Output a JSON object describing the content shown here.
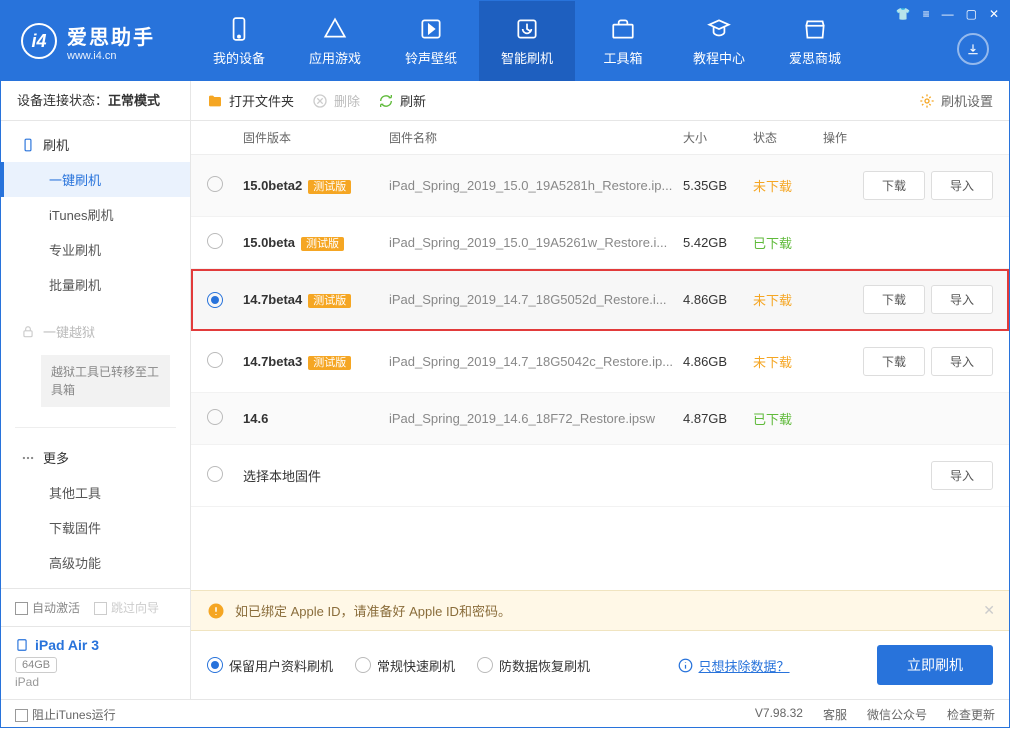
{
  "app": {
    "name": "爱思助手",
    "url": "www.i4.cn"
  },
  "nav": [
    "我的设备",
    "应用游戏",
    "铃声壁纸",
    "智能刷机",
    "工具箱",
    "教程中心",
    "爱思商城"
  ],
  "activeNav": 3,
  "status": {
    "label": "设备连接状态：",
    "value": "正常模式"
  },
  "sidebar": {
    "flash": {
      "title": "刷机",
      "items": [
        "一键刷机",
        "iTunes刷机",
        "专业刷机",
        "批量刷机"
      ],
      "active": 0
    },
    "jailbreak": {
      "title": "一键越狱",
      "note": "越狱工具已转移至工具箱"
    },
    "more": {
      "title": "更多",
      "items": [
        "其他工具",
        "下载固件",
        "高级功能"
      ]
    }
  },
  "bottomChecks": {
    "auto": "自动激活",
    "skip": "跳过向导"
  },
  "device": {
    "name": "iPad Air 3",
    "capacity": "64GB",
    "kind": "iPad"
  },
  "toolbar": {
    "open": "打开文件夹",
    "delete": "删除",
    "refresh": "刷新",
    "settings": "刷机设置"
  },
  "columns": {
    "ver": "固件版本",
    "name": "固件名称",
    "size": "大小",
    "status": "状态",
    "ops": "操作"
  },
  "rows": [
    {
      "ver": "15.0beta2",
      "beta": true,
      "name": "iPad_Spring_2019_15.0_19A5281h_Restore.ip...",
      "size": "5.35GB",
      "status": "未下载",
      "sc": "not",
      "dl": true,
      "imp": true,
      "sel": false
    },
    {
      "ver": "15.0beta",
      "beta": true,
      "name": "iPad_Spring_2019_15.0_19A5261w_Restore.i...",
      "size": "5.42GB",
      "status": "已下载",
      "sc": "done",
      "dl": false,
      "imp": false,
      "sel": false
    },
    {
      "ver": "14.7beta4",
      "beta": true,
      "name": "iPad_Spring_2019_14.7_18G5052d_Restore.i...",
      "size": "4.86GB",
      "status": "未下载",
      "sc": "not",
      "dl": true,
      "imp": true,
      "sel": true,
      "hl": true
    },
    {
      "ver": "14.7beta3",
      "beta": true,
      "name": "iPad_Spring_2019_14.7_18G5042c_Restore.ip...",
      "size": "4.86GB",
      "status": "未下载",
      "sc": "not",
      "dl": true,
      "imp": true,
      "sel": false
    },
    {
      "ver": "14.6",
      "beta": false,
      "name": "iPad_Spring_2019_14.6_18F72_Restore.ipsw",
      "size": "4.87GB",
      "status": "已下载",
      "sc": "done",
      "dl": false,
      "imp": false,
      "sel": false
    }
  ],
  "localRow": {
    "label": "选择本地固件",
    "imp": "导入"
  },
  "btns": {
    "download": "下载",
    "import": "导入"
  },
  "betaLabel": "测试版",
  "alert": "如已绑定 Apple ID，请准备好 Apple ID和密码。",
  "options": {
    "keep": "保留用户资料刷机",
    "normal": "常规快速刷机",
    "anti": "防数据恢复刷机",
    "hint": "只想抹除数据？",
    "go": "立即刷机"
  },
  "footer": {
    "block": "阻止iTunes运行",
    "version": "V7.98.32",
    "kefu": "客服",
    "wechat": "微信公众号",
    "update": "检查更新"
  }
}
